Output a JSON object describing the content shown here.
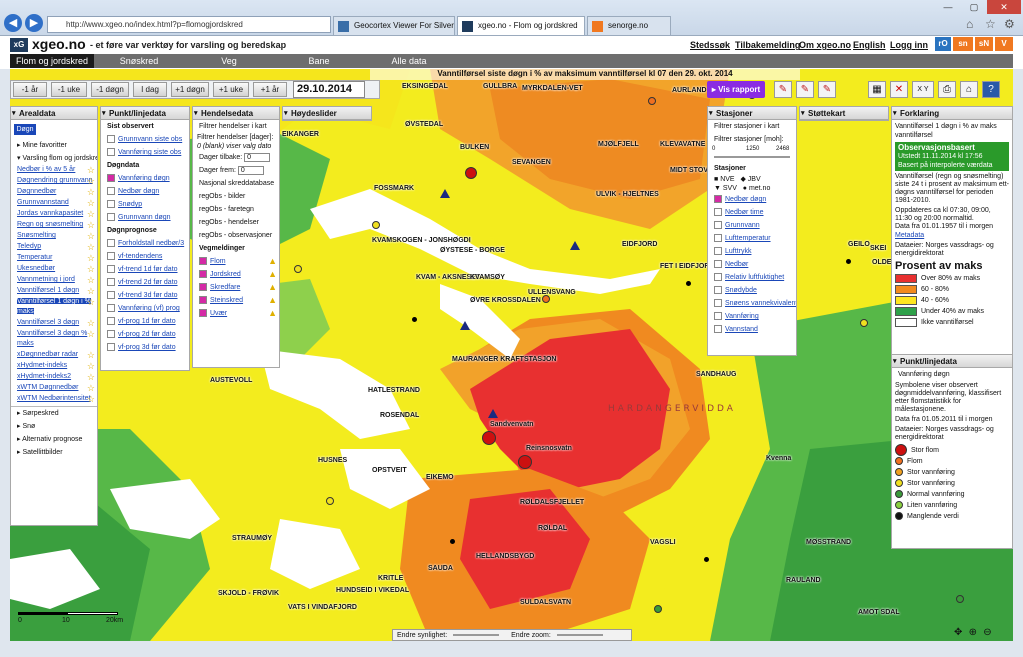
{
  "browser": {
    "url": "http://www.xgeo.no/index.html?p=flomogjordskred",
    "tabs": [
      "Geocortex Viewer For Silverlight",
      "xgeo.no - Flom og jordskred",
      "senorge.no"
    ],
    "win_min": "—",
    "win_max": "▢",
    "win_close": "✕"
  },
  "site": {
    "logo": "xG",
    "brand": "xgeo.no",
    "tagline": "- et føre var verktøy for varsling og beredskap",
    "links": [
      "Stedssøk",
      "Tilbakemelding",
      "Om xgeo.no",
      "English",
      "Logg inn"
    ],
    "partners": [
      "rO",
      "sn",
      "sN",
      "V"
    ],
    "menu": [
      "Flom og jordskred",
      "Snøskred",
      "Veg",
      "Bane",
      "Alle data"
    ]
  },
  "toolbar": {
    "title": "Vanntilførsel siste døgn i % av maksimum vanntilførsel kl 07  den 29. okt. 2014",
    "buttons": [
      "-1 år",
      "-1 uke",
      "-1 døgn",
      "I dag",
      "+1 døgn",
      "+1 uke",
      "+1 år"
    ],
    "date": "29.10.2014",
    "report": "▸ Vis rapport",
    "tools": [
      "✕",
      "X Y",
      "⎙",
      "?"
    ]
  },
  "arealdata": {
    "title": "Arealdata",
    "selected": "Døgn",
    "items": [
      "▸ Mine favoritter",
      "▾ Varsling flom og jordskred"
    ],
    "links": [
      "Nedbør i % av 5 år",
      "Døgnendring grunnvann",
      "Døgnnedbør",
      "Grunnvannstand",
      "Jordas vannkapasitet",
      "Regn og snøsmelting",
      "Snøsmelting",
      "Teledyp",
      "Temperatur",
      "Ukesnedbør",
      "Vannmetning i jord",
      "Vanntilførsel 1 døgn",
      "Vanntilførsel 1 døgn i % maks",
      "Vanntilførsel 3 døgn",
      "Vanntilførsel 3 døgn % maks",
      "xDøgnnedbør radar",
      "xHydmet-indeks",
      "xHydmet-indeks2",
      "xWTM Døgnnedbør",
      "xWTM Nedbørintensitet"
    ],
    "groups": [
      "▸ Sørpeskred",
      "▸ Snø",
      "▸ Alternativ prognose",
      "▸ Satellittbilder"
    ]
  },
  "punkt": {
    "title": "Punkt/linjedata",
    "sec1": "Sist observert",
    "obs": [
      "Grunnvann siste obs",
      "Vannføring siste obs"
    ],
    "sec2": "Døgndata",
    "dogn": [
      "Vannføring døgn",
      "Nedbør døgn",
      "Snødyp",
      "Grunnvann døgn"
    ],
    "sec3": "Døgnprognose",
    "prog": [
      "Forholdstall nedbør/3",
      "vf-tendendens",
      "vf-trend 1d før dato",
      "vf-trend 2d før dato",
      "vf-trend 3d før dato",
      "Vannføring (vf) prog",
      "vf-prog 1d før dato",
      "vf-prog 2d før dato",
      "vf-prog 3d før dato"
    ]
  },
  "hendelse": {
    "title": "Hendelsedata",
    "filter": "Filtrer hendelser i kart",
    "f1": "Filtrer hendelser [dager]:",
    "f2": "0 (blank) viser valg dato",
    "f3": "Dager tilbake:",
    "f4": "Dager frem:",
    "v3": "0",
    "v4": "0",
    "groups": [
      "Nasjonal skreddatabase",
      "regObs - bilder",
      "regObs - faretegn",
      "regObs - hendelser",
      "regObs - observasjoner"
    ],
    "veg": "Vegmeldinger",
    "veglist": [
      "Flom",
      "Jordskred",
      "Skredfare",
      "Steinskred",
      "Uvær"
    ]
  },
  "hoyde": {
    "title": "Høydeslider"
  },
  "stasjoner": {
    "title": "Stasjoner",
    "filter": "Filtrer stasjoner i kart",
    "moh": "Filtrer stasjoner [moh]:",
    "min": "0",
    "mid": "1250",
    "max": "2468",
    "sec": "Stasjoner",
    "types": [
      "NVE",
      "JBV",
      "SVV",
      "met.no"
    ],
    "list": [
      "Nedbør døgn",
      "Nedbør time",
      "Grunnvann",
      "Lufttemperatur",
      "Lufttrykk",
      "Nedbør",
      "Relativ luftfuktighet",
      "Snødybde",
      "Snøens vannekvivalent",
      "Vannføring",
      "Vannstand"
    ]
  },
  "stotte": {
    "title": "Støttekart"
  },
  "forklaring": {
    "title": "Forklaring",
    "sub": "Vanntilførsel 1 døgn i % av maks vanntilførsel",
    "badge": "Observasjonsbasert",
    "issued": "Utstedt 11.11.2014 kl 17:56",
    "basis": "Basert på interpolerte værdata",
    "desc": "Vanntilførsel (regn og snøsmelting) siste 24 t i prosent av maksimum ett-døgns vanntilførsel for perioden 1981-2010.",
    "upd": "Oppdateres ca kl 07:30, 09:00, 11:30 og 20:00 normaltid.",
    "from": "Data fra 01.01.1957 til i morgen",
    "meta": "Metadata",
    "src": "Dataeier: Norges vassdrags- og energidirektorat",
    "legtitle": "Prosent av maks",
    "legend": [
      {
        "c": "#e83030",
        "t": "Over 80% av maks"
      },
      {
        "c": "#f28a1e",
        "t": "60 - 80%"
      },
      {
        "c": "#ffe620",
        "t": "40 - 60%"
      },
      {
        "c": "#2fa14a",
        "t": "Under 40% av maks"
      },
      {
        "c": "#ffffff",
        "t": "Ikke vanntilførsel"
      }
    ]
  },
  "punkt2": {
    "title": "Punkt/linjedata",
    "sub": "Vannføring døgn",
    "desc": "Symbolene viser observert døgnmiddelvannføring, klassifisert etter flomstatistikk for målestasjonene.",
    "from": "Data fra 01.05.2011 til i morgen",
    "src": "Dataeier: Norges vassdrags- og energidirektorat",
    "legend": [
      {
        "c": "#cc1010",
        "t": "Stor flom",
        "big": true
      },
      {
        "c": "#f07020",
        "t": "Flom"
      },
      {
        "c": "#f0a020",
        "t": "Stor vannføring"
      },
      {
        "c": "#f0e020",
        "t": "Stor vannføring"
      },
      {
        "c": "#3a9a3a",
        "t": "Normal vannføring"
      },
      {
        "c": "#8ad040",
        "t": "Liten vannføring"
      },
      {
        "c": "#111111",
        "t": "Manglende verdi"
      }
    ]
  },
  "bottom": {
    "vis": "Endre synlighet:",
    "zoom": "Endre zoom:",
    "scale": [
      "0",
      "10",
      "20km"
    ]
  },
  "places": [
    "EKSINGEDAL",
    "GULLBRA",
    "MYRKDALEN-VET",
    "AURLAND",
    "ØVSTEDAL",
    "BULKEN",
    "SEVANGEN",
    "MJØLFJELL",
    "KLEVAVATNE",
    "MIDT STOV",
    "FOSSMARK",
    "ULVIK - HJELTNES",
    "EIDFJORD",
    "FET I EIDFJORD",
    "KVAMSKOGEN - JONSHØGDI",
    "ØYSTESE - BORGE",
    "KVAM - AKSNESET",
    "KVAMSØY",
    "ULLENSVANG",
    "ØVRE KROSSDALEN",
    "MAURANGER KRAFTSTASJON",
    "SANDHAUG",
    "AUSTEVOLL",
    "HATLESTRAND",
    "ROSENDAL",
    "HUSNES",
    "OPSTVEIT",
    "EIKEMO",
    "RØLDALSFJELLET",
    "RØLDAL",
    "STRAUMØY",
    "SAUDA",
    "HELLANDSBYGD",
    "KRITLE",
    "SULDALSVATN",
    "SKJOLD - FRØVIK",
    "VATS I VINDAFJORD",
    "HUNDSEID I VIKEDAL",
    "RAULAND",
    "AMOT SDAL",
    "MØSSTRAND",
    "VAGSLI",
    "GEILO",
    "OLDEBRA",
    "SKEI",
    "EIKANGER",
    "Sandvenvatn",
    "Reinsnosvatn",
    "Kvenna",
    "HARDANGERVIDDA"
  ]
}
